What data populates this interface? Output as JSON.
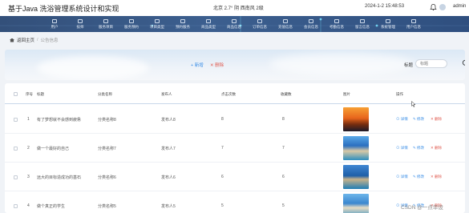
{
  "header": {
    "title": "基于Java 洗浴管理系统设计和实现",
    "weather": "北京 2.7° 阴 西南风 2级",
    "datetime": "2024-1-2 15:48:53",
    "user": "admin"
  },
  "nav": {
    "items": [
      {
        "label": "用户"
      },
      {
        "label": "技师"
      },
      {
        "label": "服务项目"
      },
      {
        "label": "服务预约"
      },
      {
        "label": "项目类型"
      },
      {
        "label": "预约服务"
      },
      {
        "label": "商品类型"
      },
      {
        "label": "商品信息"
      },
      {
        "label": "订单信息"
      },
      {
        "label": "充值信息"
      },
      {
        "label": "会员信息"
      },
      {
        "label": "考勤信息"
      },
      {
        "label": "留言信息"
      },
      {
        "label": "系统管理"
      },
      {
        "label": "用户信息"
      }
    ]
  },
  "breadcrumb": {
    "home": "返回主页",
    "separator": "/",
    "current": "公告信息"
  },
  "actions": {
    "add": "+ 新增",
    "delete": "✕ 删除",
    "search_label": "标题",
    "search_placeholder": "标题"
  },
  "table": {
    "headers": {
      "index": "序号",
      "title": "标题",
      "category": "分类名称",
      "publisher": "发布人",
      "clicks": "点击次数",
      "favorites": "收藏数",
      "image": "图片",
      "ops": "操作"
    },
    "rows": [
      {
        "index": "1",
        "title": "有了梦想就不会感到疲惫",
        "category": "分类名称8",
        "publisher": "发布人8",
        "clicks": "8",
        "favorites": "8"
      },
      {
        "index": "2",
        "title": "做一个最好的自己",
        "category": "分类名称7",
        "publisher": "发布人7",
        "clicks": "7",
        "favorites": "7"
      },
      {
        "index": "3",
        "title": "远大的目标造成功的基石",
        "category": "分类名称6",
        "publisher": "发布人6",
        "clicks": "6",
        "favorites": "6"
      },
      {
        "index": "4",
        "title": "做个真正的学生",
        "category": "分类名称5",
        "publisher": "发布人5",
        "clicks": "5",
        "favorites": "5"
      }
    ],
    "row_actions": {
      "detail": "详情",
      "edit": "修改",
      "delete": "✕ 删除"
    }
  },
  "watermark": "CSDN @一点毕设"
}
